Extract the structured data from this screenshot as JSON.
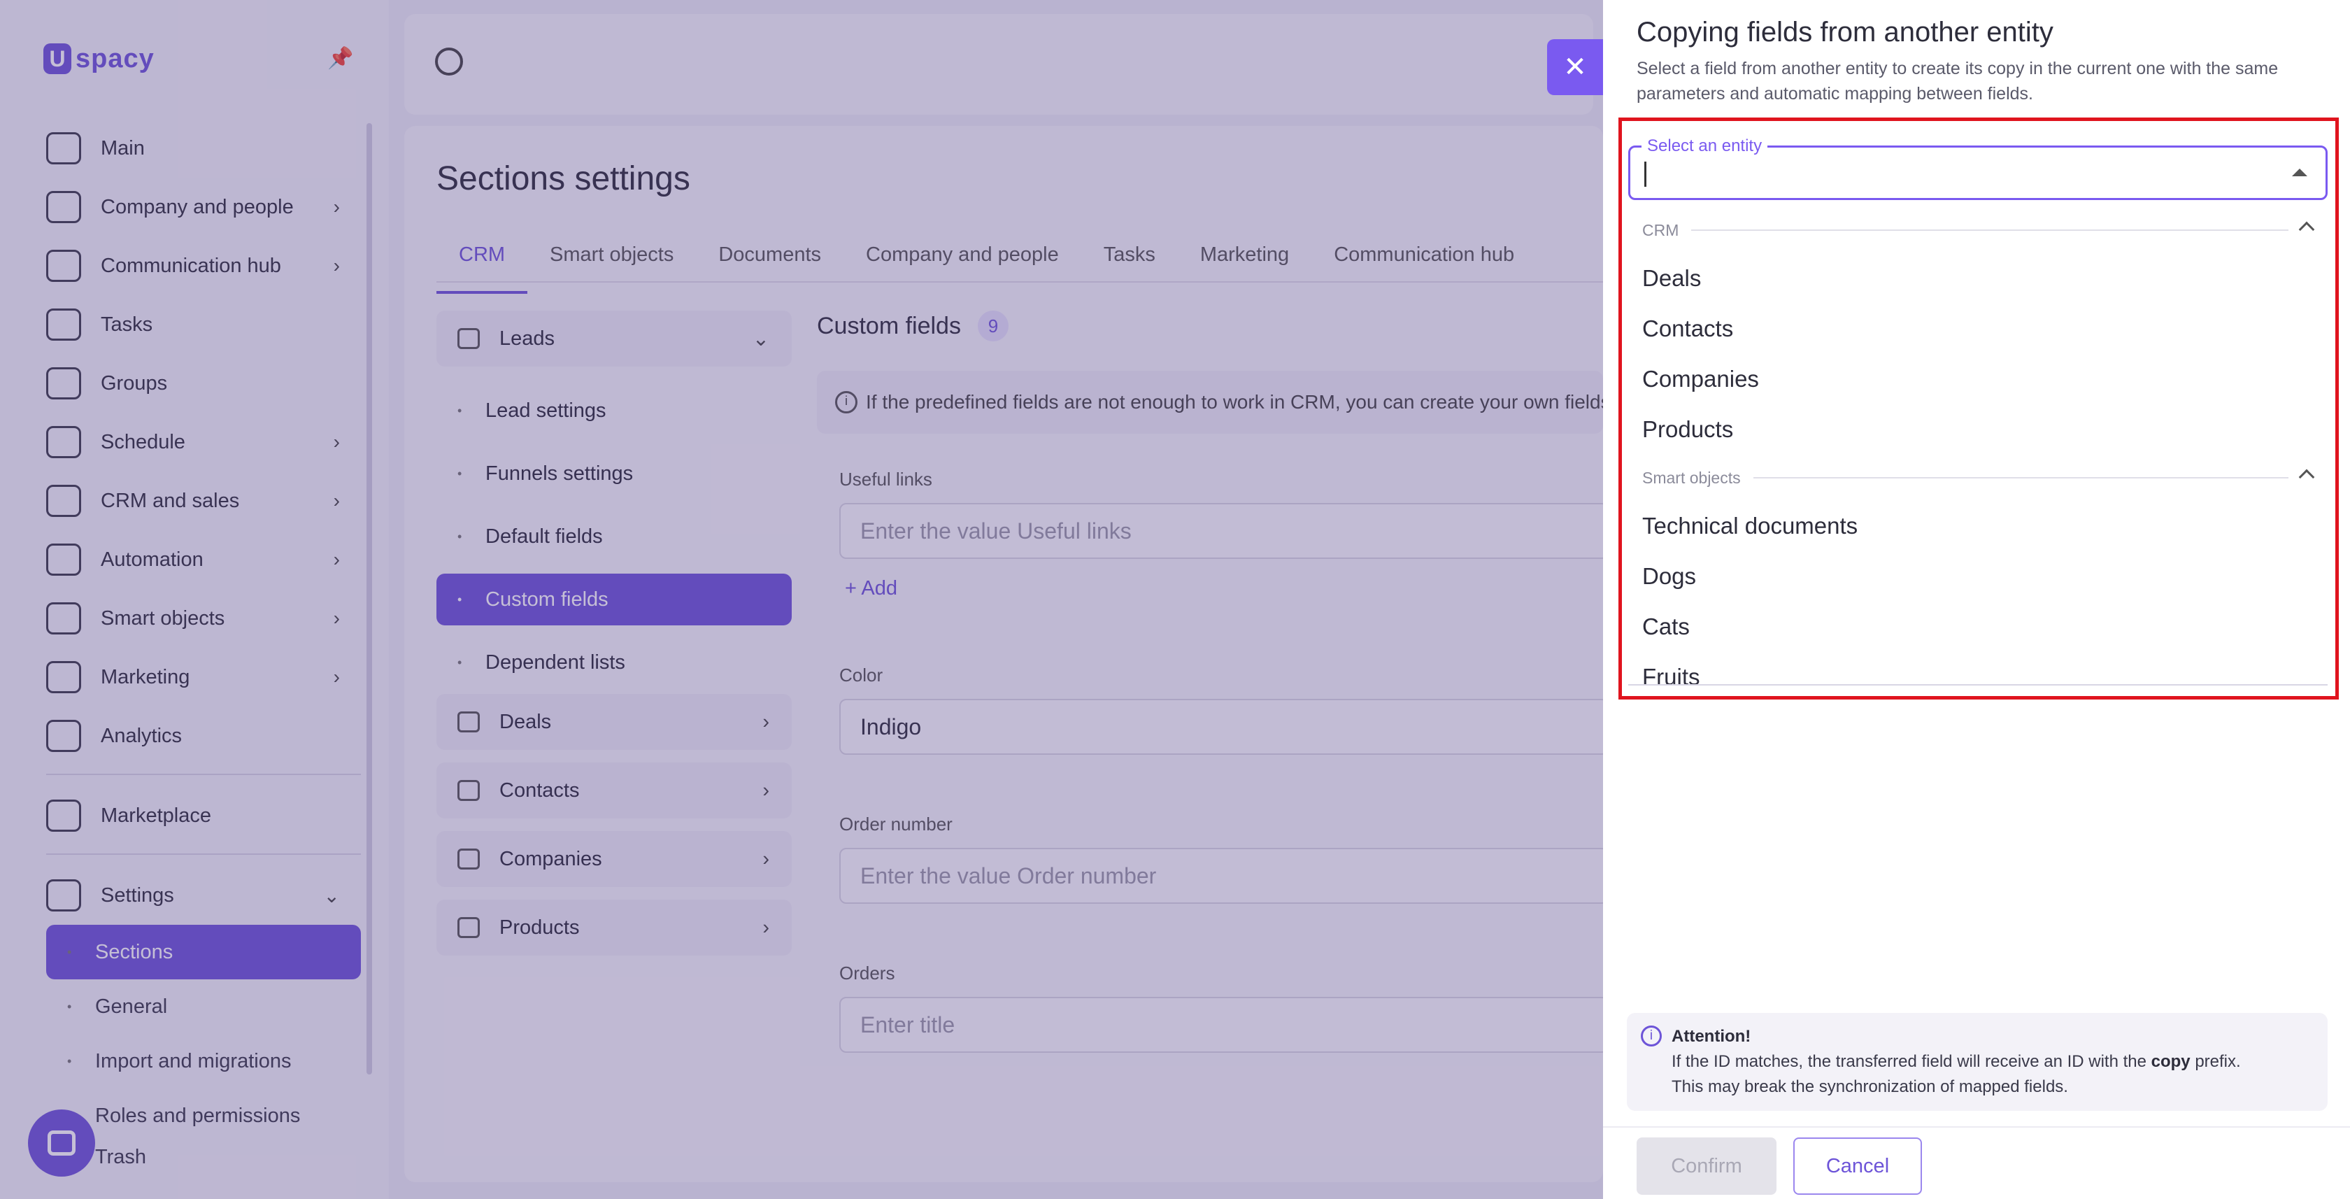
{
  "brand": {
    "logo_letter": "U",
    "logo_text": "spacy"
  },
  "sidebar": {
    "items": [
      {
        "label": "Main",
        "icon": "home-icon",
        "chevron": false
      },
      {
        "label": "Company and people",
        "icon": "building-icon",
        "chevron": true
      },
      {
        "label": "Communication hub",
        "icon": "chat-icon",
        "chevron": true
      },
      {
        "label": "Tasks",
        "icon": "check-circle-icon",
        "chevron": false
      },
      {
        "label": "Groups",
        "icon": "people-icon",
        "chevron": false
      },
      {
        "label": "Schedule",
        "icon": "calendar-icon",
        "chevron": true
      },
      {
        "label": "CRM and sales",
        "icon": "database-icon",
        "chevron": true
      },
      {
        "label": "Automation",
        "icon": "lightning-icon",
        "chevron": true
      },
      {
        "label": "Smart objects",
        "icon": "scan-icon",
        "chevron": true
      },
      {
        "label": "Marketing",
        "icon": "megaphone-icon",
        "chevron": true
      },
      {
        "label": "Analytics",
        "icon": "chart-icon",
        "chevron": false
      }
    ],
    "marketplace": "Marketplace",
    "settings": "Settings",
    "settings_sub": [
      "Sections",
      "General",
      "Import and migrations",
      "Roles and permissions",
      "Trash"
    ]
  },
  "main": {
    "title": "Sections settings",
    "tabs": [
      "CRM",
      "Smart objects",
      "Documents",
      "Company and people",
      "Tasks",
      "Marketing",
      "Communication hub"
    ],
    "subnav": {
      "leads": "Leads",
      "leads_links": [
        "Lead settings",
        "Funnels settings",
        "Default fields",
        "Custom fields",
        "Dependent lists"
      ],
      "groups": [
        "Deals",
        "Contacts",
        "Companies",
        "Products"
      ]
    },
    "custom_fields_title": "Custom fields",
    "custom_fields_count": "9",
    "info_text": "If the predefined fields are not enough to work in CRM, you can create your own fields",
    "useful_links_label": "Useful links",
    "useful_links_placeholder": "Enter the value Useful links",
    "add_label": "+ Add",
    "color_label": "Color",
    "color_value": "Indigo",
    "order_number_label": "Order number",
    "order_number_placeholder": "Enter the value Order number",
    "orders_label": "Orders",
    "orders_placeholder": "Enter title"
  },
  "panel": {
    "title": "Copying fields from another entity",
    "subtitle": "Select a field from another entity to create its copy in the current one with the same parameters and automatic mapping between fields.",
    "select_label": "Select an entity",
    "groups": [
      {
        "name": "CRM",
        "options": [
          "Deals",
          "Contacts",
          "Companies",
          "Products"
        ]
      },
      {
        "name": "Smart objects",
        "options": [
          "Technical documents",
          "Dogs",
          "Cats",
          "Fruits"
        ]
      }
    ],
    "attention_title": "Attention!",
    "attention_line1_pre": "If the ID matches, the transferred field will receive an ID with the ",
    "attention_bold": "copy",
    "attention_line1_post": " prefix.",
    "attention_line2": "This may break the synchronization of mapped fields.",
    "confirm": "Confirm",
    "cancel": "Cancel"
  },
  "colors": {
    "accent": "#6d54d8",
    "highlight": "#e0141e"
  }
}
